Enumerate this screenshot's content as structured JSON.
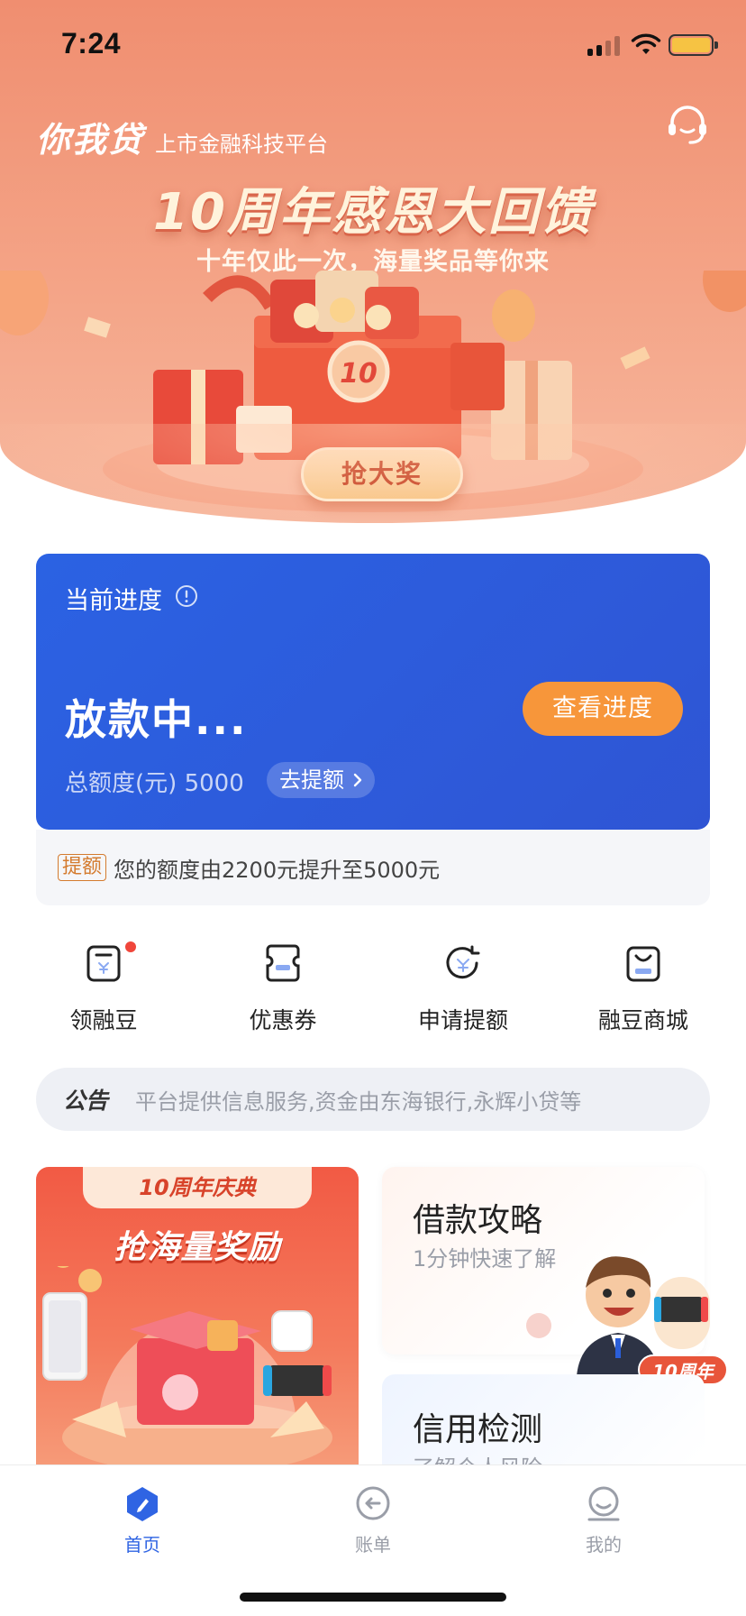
{
  "status_bar": {
    "time": "7:24"
  },
  "header": {
    "brand_name": "你我贷",
    "brand_tagline": "上市金融科技平台"
  },
  "banner": {
    "title": "10周年感恩大回馈",
    "subtitle": "十年仅此一次，海量奖品等你来",
    "cta": "抢大奖",
    "logo_text": "10"
  },
  "progress_card": {
    "label": "当前进度",
    "status": "放款中...",
    "button": "查看进度",
    "limit_label": "总额度(元)",
    "limit_value": "5000",
    "raise_link": "去提额"
  },
  "notice": {
    "tag": "提额",
    "text": "您的额度由2200元提升至5000元"
  },
  "quick_actions": [
    {
      "label": "领融豆",
      "icon": "bean-icon",
      "has_badge": true
    },
    {
      "label": "优惠券",
      "icon": "coupon-icon",
      "has_badge": false
    },
    {
      "label": "申请提额",
      "icon": "raise-limit-icon",
      "has_badge": false
    },
    {
      "label": "融豆商城",
      "icon": "shop-bag-icon",
      "has_badge": false
    }
  ],
  "announcement": {
    "label": "公告",
    "text": "平台提供信息服务,资金由东海银行,永辉小贷等"
  },
  "promos": {
    "left": {
      "ribbon": "10周年庆典",
      "headline": "抢海量奖励"
    },
    "right_top": {
      "title": "借款攻略",
      "subtitle": "1分钟快速了解",
      "badge": "10周年"
    },
    "right_bottom": {
      "title": "信用检测",
      "subtitle": "了解个人风险"
    }
  },
  "tabbar": [
    {
      "label": "首页",
      "icon": "home-icon",
      "active": true
    },
    {
      "label": "账单",
      "icon": "bill-icon",
      "active": false
    },
    {
      "label": "我的",
      "icon": "profile-icon",
      "active": false
    }
  ],
  "colors": {
    "hero": "#f08e70",
    "card_blue": "#2b62e3",
    "accent_orange": "#f7963a",
    "active_tab": "#2f64e3"
  }
}
